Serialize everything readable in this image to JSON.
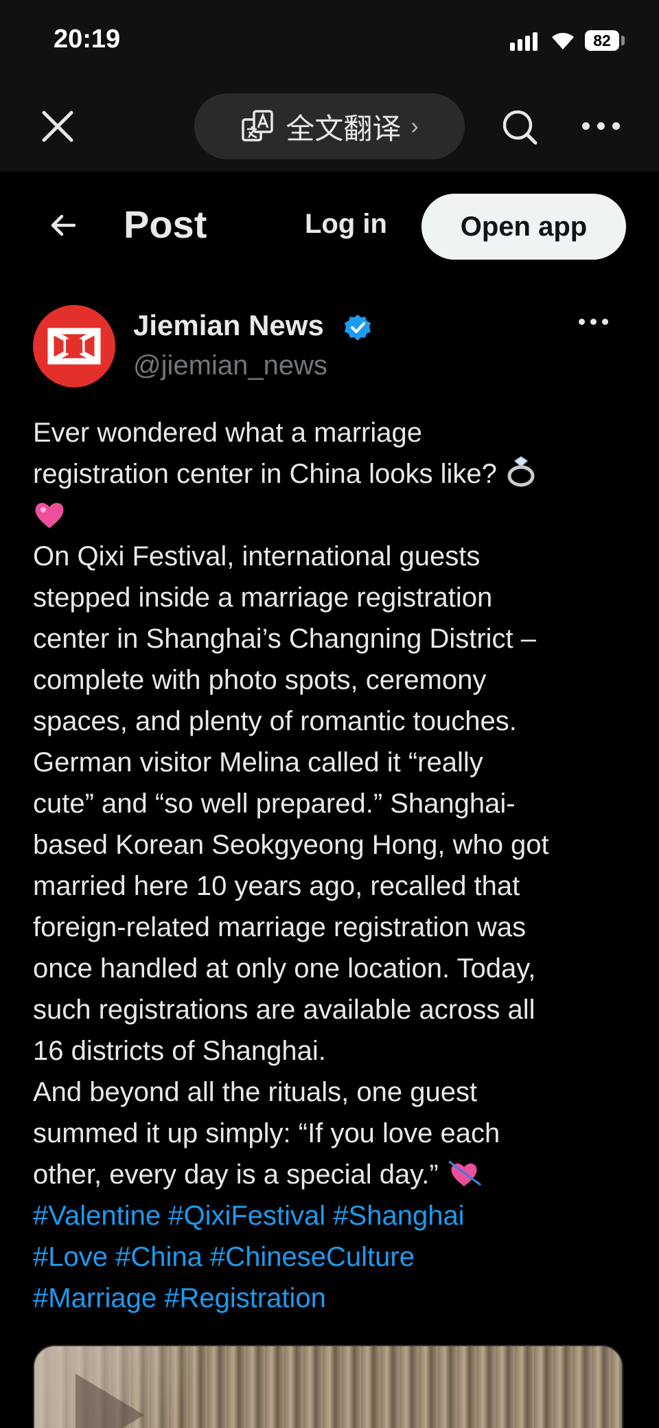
{
  "status_bar": {
    "time": "20:19",
    "battery": "82"
  },
  "browser_toolbar": {
    "translate_label": "全文翻译",
    "translate_chevron": "›"
  },
  "post_header": {
    "title": "Post",
    "login_label": "Log in",
    "open_app_label": "Open app"
  },
  "author": {
    "name": "Jiemian News",
    "handle": "@jiemian_news",
    "verified": true,
    "avatar_color": "#e4302a"
  },
  "post": {
    "lines": [
      "Ever wondered what a marriage",
      "registration center in China looks like?",
      "On Qixi Festival, international guests",
      "stepped inside a marriage registration",
      "center in Shanghai’s Changning District –",
      "complete with photo spots, ceremony",
      "spaces, and plenty of romantic touches.",
      "German visitor Melina called it “really",
      "cute” and “so well prepared.” Shanghai-",
      "based Korean Seokgyeong Hong, who got",
      "married here 10 years ago, recalled that",
      "foreign-related marriage registration was",
      "once handled at only one location. Today,",
      "such registrations are available across all",
      "16 districts of Shanghai.",
      "And beyond all the rituals, one guest",
      "summed it up simply: “If you love each",
      "other, every day is a special day.”"
    ],
    "hashtags": [
      [
        "#Valentine",
        "#QixiFestival",
        "#Shanghai"
      ],
      [
        "#Love",
        "#China",
        "#ChineseCulture"
      ],
      [
        "#Marriage",
        "#Registration"
      ]
    ],
    "emojis": [
      "ring-emoji",
      "pink-heart-emoji",
      "heart-arrow-emoji"
    ]
  },
  "colors": {
    "link": "#1d9bf0",
    "background": "#000000",
    "text": "#e7e9ea",
    "muted": "#71767b"
  }
}
